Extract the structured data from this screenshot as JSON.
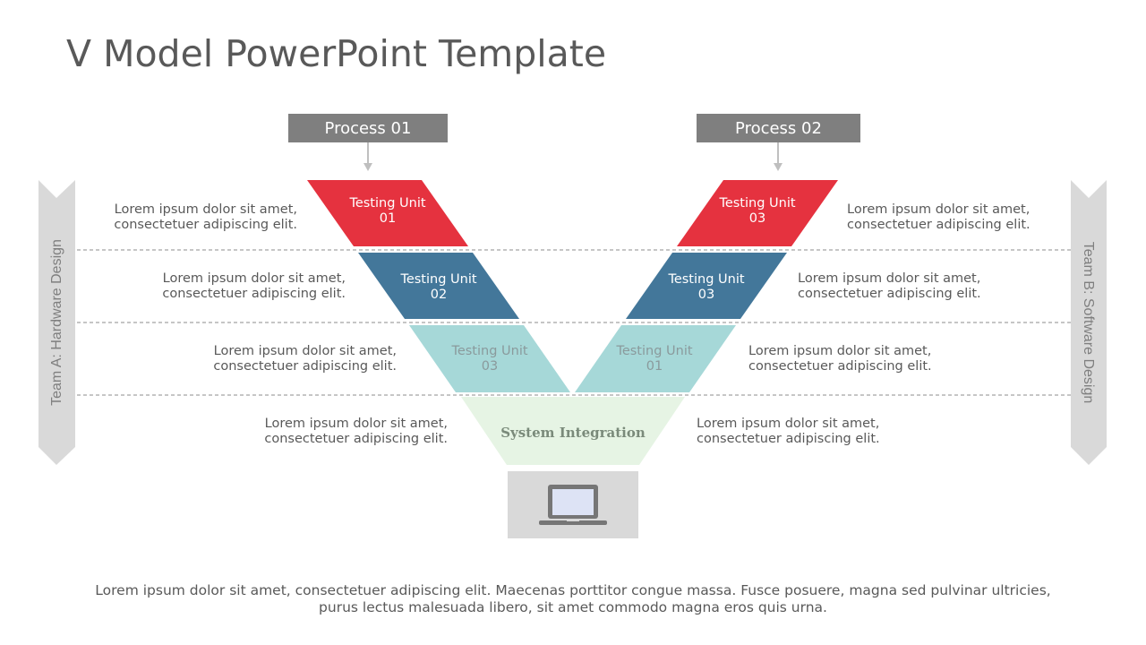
{
  "title": "V Model PowerPoint Template",
  "processes": [
    {
      "label": "Process 01"
    },
    {
      "label": "Process 02"
    }
  ],
  "side_labels": {
    "left": "Team A: Hardware Design",
    "right": "Team B: Software Design"
  },
  "units": {
    "left": [
      {
        "line1": "Testing Unit",
        "line2": "01",
        "color": "#e5323f"
      },
      {
        "line1": "Testing Unit",
        "line2": "02",
        "color": "#43779a"
      },
      {
        "line1": "Testing Unit",
        "line2": "03",
        "color": "#a6d8d8"
      }
    ],
    "right": [
      {
        "line1": "Testing Unit",
        "line2": "03",
        "color": "#e5323f"
      },
      {
        "line1": "Testing Unit",
        "line2": "03",
        "color": "#43779a"
      },
      {
        "line1": "Testing Unit",
        "line2": "01",
        "color": "#a6d8d8"
      }
    ]
  },
  "system_integration": {
    "label": "System Integration",
    "color": "#e6f4e4"
  },
  "descriptions": {
    "left": [
      {
        "line1": "Lorem ipsum dolor sit amet,",
        "line2": "consectetuer adipiscing  elit."
      },
      {
        "line1": "Lorem ipsum dolor sit amet,",
        "line2": "consectetuer adipiscing  elit."
      },
      {
        "line1": "Lorem ipsum dolor sit amet,",
        "line2": "consectetuer adipiscing  elit."
      },
      {
        "line1": "Lorem ipsum dolor sit amet,",
        "line2": "consectetuer adipiscing  elit."
      }
    ],
    "right": [
      {
        "line1": "Lorem ipsum dolor sit amet,",
        "line2": "consectetuer adipiscing  elit."
      },
      {
        "line1": "Lorem ipsum dolor sit amet,",
        "line2": "consectetuer adipiscing  elit."
      },
      {
        "line1": "Lorem ipsum dolor sit amet,",
        "line2": "consectetuer adipiscing  elit."
      },
      {
        "line1": "Lorem ipsum dolor sit amet,",
        "line2": "consectetuer adipiscing  elit."
      }
    ]
  },
  "laptop_icon": "laptop-icon",
  "footer": "Lorem ipsum dolor sit amet, consectetuer adipiscing elit. Maecenas porttitor congue massa. Fusce posuere, magna sed pulvinar ultricies, purus lectus malesuada libero, sit amet commodo magna eros quis urna.",
  "colors": {
    "process_box": "#7f7f7f",
    "side_arrow": "#d9d9d9",
    "laptop_box": "#d9d9d9",
    "divider": "#7f7f7f"
  }
}
